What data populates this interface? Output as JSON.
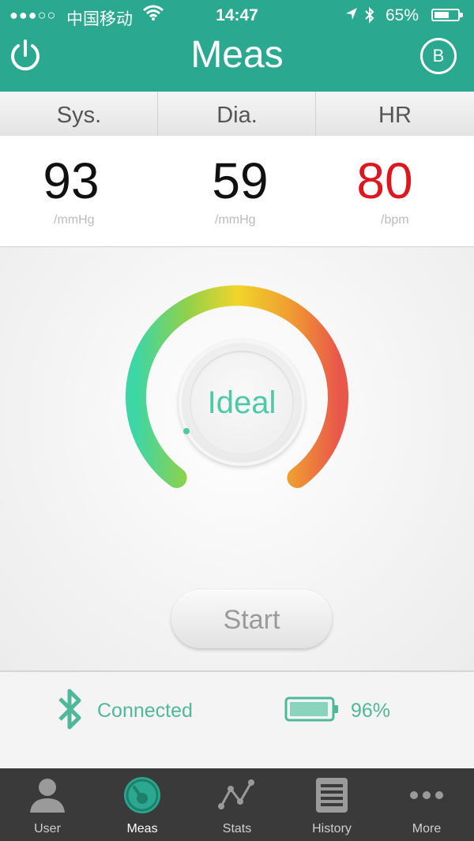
{
  "status_bar": {
    "signal_dots": "●●●○○",
    "carrier": "中国移动",
    "time": "14:47",
    "battery_percent": "65%",
    "battery_level": 0.65
  },
  "nav": {
    "title": "Meas",
    "left_icon": "power-icon",
    "right_icon_letter": "B"
  },
  "readings": {
    "headers": [
      "Sys.",
      "Dia.",
      "HR"
    ],
    "sys": {
      "value": "93",
      "unit": "/mmHg"
    },
    "dia": {
      "value": "59",
      "unit": "/mmHg"
    },
    "hr": {
      "value": "80",
      "unit": "/bpm"
    }
  },
  "gauge": {
    "label": "Ideal"
  },
  "start_button": {
    "label": "Start"
  },
  "device": {
    "connection_label": "Connected",
    "battery_label": "96%",
    "battery_level": 0.96
  },
  "tabs": [
    {
      "label": "User",
      "icon": "user-icon"
    },
    {
      "label": "Meas",
      "icon": "gauge-icon"
    },
    {
      "label": "Stats",
      "icon": "stats-icon"
    },
    {
      "label": "History",
      "icon": "history-icon"
    },
    {
      "label": "More",
      "icon": "more-icon"
    }
  ],
  "colors": {
    "brand": "#2ba890",
    "hr_value": "#e0161e",
    "accent_text": "#4fb89a"
  }
}
